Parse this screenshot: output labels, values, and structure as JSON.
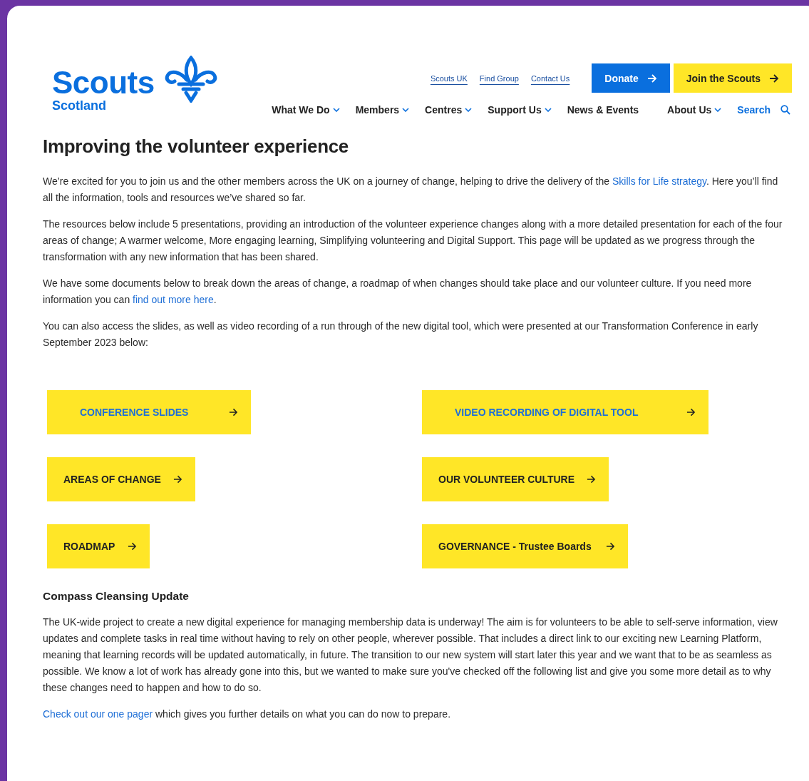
{
  "logo": {
    "name": "Scouts",
    "region": "Scotland"
  },
  "utility_links": [
    "Scouts UK",
    "Find Group",
    "Contact Us"
  ],
  "header_buttons": [
    {
      "label": "Donate",
      "kind": "blue"
    },
    {
      "label": "Join the Scouts",
      "kind": "yellow"
    }
  ],
  "nav": [
    {
      "label": "What We Do",
      "dropdown": true
    },
    {
      "label": "Members",
      "dropdown": true
    },
    {
      "label": "Centres",
      "dropdown": true
    },
    {
      "label": "Support Us",
      "dropdown": true
    },
    {
      "label": "News & Events",
      "dropdown": false
    },
    {
      "label": "About Us",
      "dropdown": true
    }
  ],
  "search": {
    "label": "Search"
  },
  "heading": "Improving the volunteer experience",
  "paragraphs": [
    [
      {
        "kind": "text",
        "text": "We’re excited for you to join us and the other members across the UK on a journey of change, helping to drive the delivery of the "
      },
      {
        "kind": "link",
        "text": "Skills for Life strategy"
      },
      {
        "kind": "text",
        "text": ". Here you’ll find all the information, tools and resources we’ve shared so far."
      }
    ],
    [
      {
        "kind": "text",
        "text": "The resources below include 5 presentations, providing an introduction of the volunteer experience changes along with a more detailed presentation for each of the four areas of change; A warmer welcome, More engaging learning, Simplifying volunteering and Digital Support. This page will be updated as we progress through the transformation with any new information that has been shared."
      }
    ],
    [
      {
        "kind": "text",
        "text": "We have some documents below to break down the areas of change, a roadmap of when changes should take place and our volunteer culture. If you need more information you can "
      },
      {
        "kind": "link",
        "text": "find out more here"
      },
      {
        "kind": "text",
        "text": "."
      }
    ],
    [
      {
        "kind": "text",
        "text": "You can also access the slides, as well as video recording of a run through of the new digital tool, which were presented at our Transformation Conference in early September 2023 below:"
      }
    ]
  ],
  "resource_buttons": [
    {
      "label": "CONFERENCE SLIDES",
      "highlighted": true
    },
    {
      "label": "VIDEO RECORDING OF DIGITAL TOOL",
      "highlighted": true
    },
    {
      "label": "AREAS OF CHANGE",
      "highlighted": false
    },
    {
      "label": "OUR VOLUNTEER CULTURE",
      "highlighted": false
    },
    {
      "label": "ROADMAP",
      "highlighted": false
    },
    {
      "label": "GOVERNANCE - Trustee Boards",
      "highlighted": false
    }
  ],
  "subheading": "Compass Cleansing Update",
  "paragraphs_2": [
    [
      {
        "kind": "text",
        "text": "The UK-wide project to create a new digital experience for managing membership data is underway! The aim is for volunteers to be able to self-serve information, view updates and complete tasks in real time without having to rely on other people, wherever possible. That includes a direct link to our exciting new Learning Platform, meaning that learning records will be updated automatically, in future. The transition to our new system will start later this year and we want that to be as seamless as possible. We know a lot of work has already gone into this, but we wanted to make sure you've checked off the following list and give you some more detail as to why these changes need to happen and how to do so."
      }
    ],
    [
      {
        "kind": "link",
        "text": "Check out our one pager"
      },
      {
        "kind": "text",
        "text": " which gives you further details on what you can do now to prepare."
      }
    ]
  ]
}
